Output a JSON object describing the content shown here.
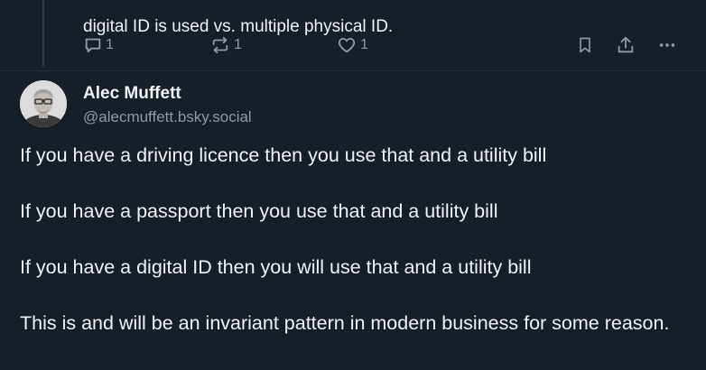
{
  "previous_post": {
    "text_line": "digital ID is used vs. multiple physical ID.",
    "reply_count": "1",
    "repost_count": "1",
    "like_count": "1"
  },
  "post": {
    "author_name": "Alec Muffett",
    "author_handle": "@alecmuffett.bsky.social",
    "paragraphs": [
      "If you have a driving licence then you use that and a utility bill",
      "If you have a passport then you use that and a utility bill",
      "If you have a digital ID then you will use that and a utility bill",
      "This is and will be an invariant pattern in modern business for some reason."
    ]
  },
  "colors": {
    "background": "#161e27",
    "text": "#f1f3f5",
    "muted": "#8d9aab"
  },
  "icons": {
    "reply": "reply-icon",
    "repost": "repost-icon",
    "like": "heart-icon",
    "bookmark": "bookmark-icon",
    "share": "share-icon",
    "more": "more-icon"
  }
}
